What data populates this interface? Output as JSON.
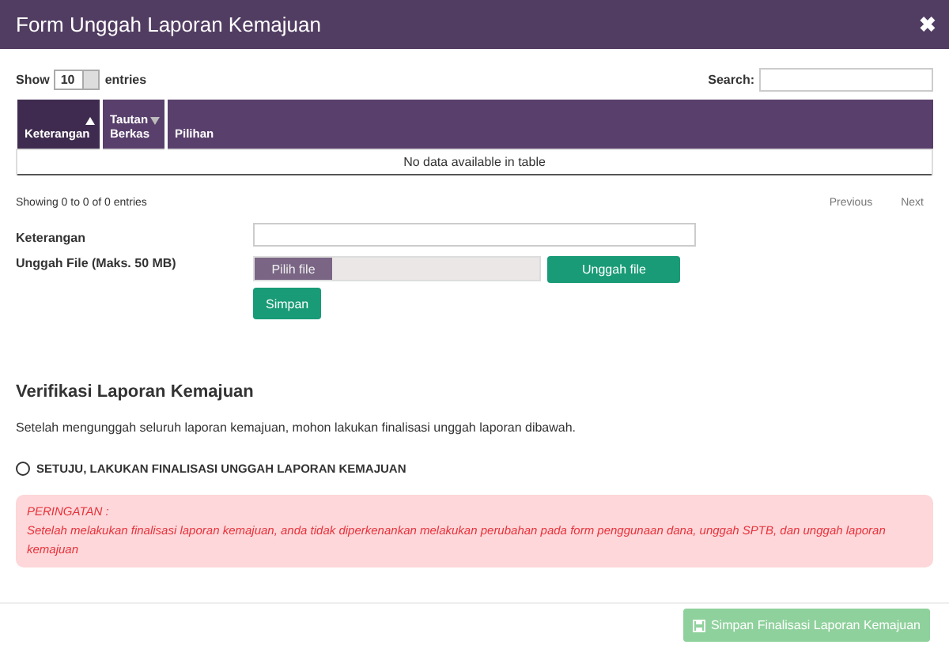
{
  "window": {
    "title": "Form Unggah Laporan Kemajuan",
    "close": "✖"
  },
  "table_controls": {
    "show_label": "Show",
    "page_length": "10",
    "entries_label": "entries",
    "search_label": "Search:"
  },
  "table": {
    "columns": [
      {
        "label": "Keterangan",
        "sortable": true,
        "sorted": true
      },
      {
        "label": "Tautan Berkas",
        "sortable": true,
        "sorted": false
      },
      {
        "label": "Pilihan",
        "sortable": false,
        "sorted": false
      }
    ],
    "empty_message": "No data available in table"
  },
  "table_info": "Showing 0 to 0 of 0 entries",
  "pagination": [
    {
      "label": "Previous",
      "disabled": true
    },
    {
      "label": "Next",
      "disabled": true
    }
  ],
  "form": {
    "keterangan_label": "Keterangan",
    "upload_label": "Unggah File (Maks. 50 MB)",
    "choose_button": "Pilih file",
    "upload_button": "Unggah file",
    "save_button": "Simpan"
  },
  "verification": {
    "title": "Verifikasi Laporan Kemajuan",
    "description": "Setelah mengunggah seluruh laporan kemajuan, mohon lakukan finalisasi unggah laporan dibawah.",
    "agree": {
      "label": "SETUJU, LAKUKAN FINALISASI UNGGAH LAPORAN KEMAJUAN",
      "checked": false
    },
    "warning_title": "PERINGATAN :",
    "warning_text": "Setelah melakukan finalisasi laporan kemajuan, anda tidak diperkenankan melakukan perubahan pada form penggunaan dana, unggah SPTB, dan unggah laporan kemajuan"
  },
  "final_button": {
    "label": "Simpan Finalisasi Laporan Kemajuan",
    "disabled": true
  }
}
